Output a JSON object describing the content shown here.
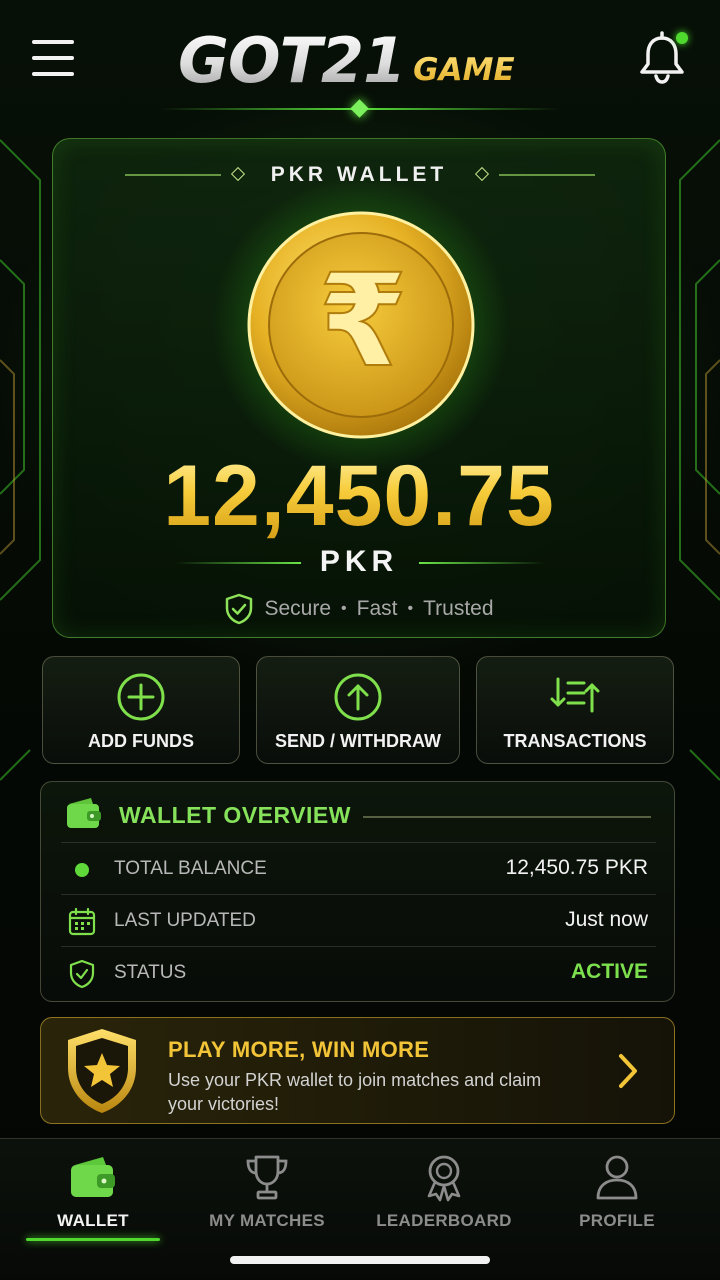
{
  "header": {
    "logo_main": "GOT21",
    "logo_sub": "GAME",
    "has_notification": true,
    "menu_icon": "hamburger-menu-icon",
    "bell_icon": "bell-icon"
  },
  "wallet": {
    "title": "PKR WALLET",
    "coin_icon": "rupee-coin-icon",
    "coin_symbol": "₹",
    "balance": "12,450.75",
    "currency": "PKR",
    "tags": [
      "Secure",
      "Fast",
      "Trusted"
    ]
  },
  "actions": [
    {
      "label": "ADD FUNDS",
      "icon": "plus-circle-icon"
    },
    {
      "label": "SEND / WITHDRAW",
      "icon": "arrow-up-circle-icon"
    },
    {
      "label": "TRANSACTIONS",
      "icon": "transactions-icon"
    }
  ],
  "overview": {
    "title": "WALLET OVERVIEW",
    "rows": [
      {
        "label": "TOTAL BALANCE",
        "value": "12,450.75 PKR",
        "icon": "green-dot-icon"
      },
      {
        "label": "LAST UPDATED",
        "value": "Just now",
        "icon": "calendar-icon"
      },
      {
        "label": "STATUS",
        "value": "ACTIVE",
        "icon": "shield-check-icon"
      }
    ]
  },
  "promo": {
    "title": "PLAY MORE, WIN MORE",
    "description": "Use your PKR wallet to join matches and claim your victories!"
  },
  "nav": [
    {
      "label": "WALLET",
      "icon": "wallet-icon",
      "active": true
    },
    {
      "label": "MY MATCHES",
      "icon": "trophy-icon",
      "active": false
    },
    {
      "label": "LEADERBOARD",
      "icon": "medal-icon",
      "active": false
    },
    {
      "label": "PROFILE",
      "icon": "user-icon",
      "active": false
    }
  ],
  "colors": {
    "accent_green": "#4fd82e",
    "gold": "#f2c437",
    "background": "#050a05"
  }
}
